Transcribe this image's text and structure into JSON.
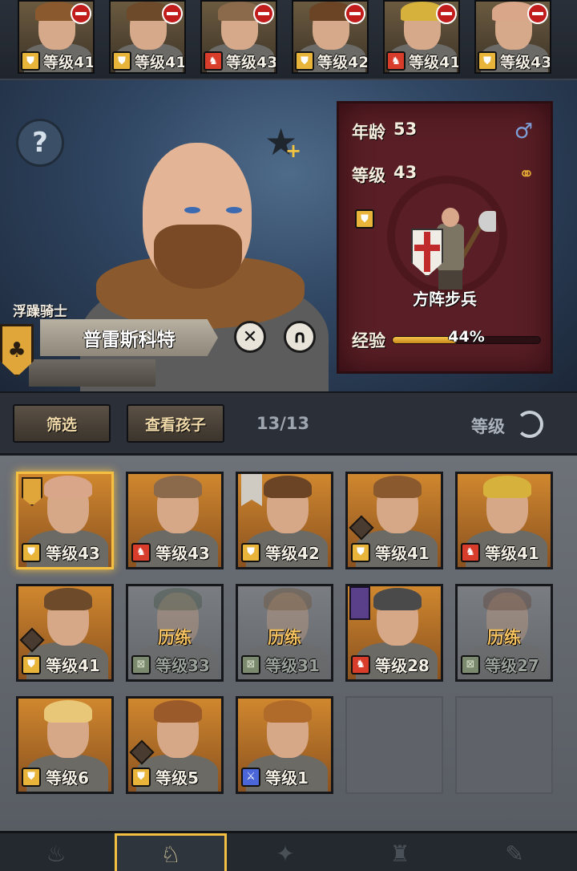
{
  "top_strip": {
    "cards": [
      {
        "level": "等级41",
        "badge": "shield",
        "hair": "#8a5a2e"
      },
      {
        "level": "等级41",
        "badge": "shield",
        "hair": "#6d4a2a"
      },
      {
        "level": "等级43",
        "badge": "bear",
        "hair": "#8a6a4a"
      },
      {
        "level": "等级42",
        "badge": "shield",
        "hair": "#6a4424"
      },
      {
        "level": "等级41",
        "badge": "bear",
        "hair": "#d6b23c"
      },
      {
        "level": "等级43",
        "badge": "shield",
        "hair": "#d9a68a"
      }
    ]
  },
  "hero": {
    "nobility": "浮躁骑士",
    "name": "普雷斯科特",
    "age_label": "年龄",
    "age": "53",
    "level_label": "等级",
    "level": "43",
    "unit_type": "方阵步兵",
    "xp_label": "经验",
    "xp_percent_text": "44%",
    "xp_percent": 44,
    "gender_icon": "male-icon",
    "marriage_icon": "ring-icon"
  },
  "toolbar": {
    "filter_label": "筛选",
    "children_label": "查看孩子",
    "count": "13/13",
    "sort_label": "等级"
  },
  "roster": [
    {
      "state": "filled",
      "selected": true,
      "level": "等级43",
      "badge": "shield",
      "hair": "#d9a68a",
      "marker": "crest"
    },
    {
      "state": "filled",
      "level": "等级43",
      "badge": "bear",
      "hair": "#8a6a4a"
    },
    {
      "state": "filled",
      "level": "等级42",
      "badge": "shield",
      "hair": "#6a4424",
      "marker": "banner"
    },
    {
      "state": "filled",
      "level": "等级41",
      "badge": "shield",
      "hair": "#8a5a2e",
      "marker": "class"
    },
    {
      "state": "filled",
      "level": "等级41",
      "badge": "bear",
      "hair": "#d6b23c"
    },
    {
      "state": "filled",
      "level": "等级41",
      "badge": "shield",
      "hair": "#6d4a2a",
      "marker": "class"
    },
    {
      "state": "training",
      "label": "历练",
      "level": "等级33",
      "badge": "gray",
      "hair": "#3a4a3a"
    },
    {
      "state": "training",
      "label": "历练",
      "level": "等级31",
      "badge": "gray",
      "hair": "#6a4a2a"
    },
    {
      "state": "filled",
      "level": "等级28",
      "badge": "bear",
      "hair": "#4a4a4a",
      "marker": "tower"
    },
    {
      "state": "training",
      "label": "历练",
      "level": "等级27",
      "badge": "gray",
      "hair": "#5a3a2a"
    },
    {
      "state": "filled",
      "level": "等级6",
      "badge": "shield",
      "hair": "#e8c878"
    },
    {
      "state": "filled",
      "level": "等级5",
      "badge": "shield",
      "hair": "#9a5a2a",
      "marker": "class"
    },
    {
      "state": "filled",
      "level": "等级1",
      "badge": "sword",
      "hair": "#b06a2a"
    },
    {
      "state": "empty"
    },
    {
      "state": "empty"
    }
  ],
  "bottom_nav": [
    {
      "icon": "torch-icon",
      "active": false
    },
    {
      "icon": "horse-head-icon",
      "active": true
    },
    {
      "icon": "compass-icon",
      "active": false
    },
    {
      "icon": "castle-icon",
      "active": false
    },
    {
      "icon": "scroll-icon",
      "active": false
    }
  ]
}
